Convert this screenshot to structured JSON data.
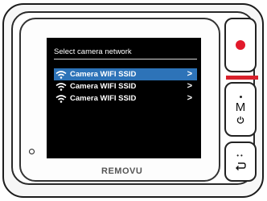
{
  "screen": {
    "title": "Select camera network",
    "networks": [
      {
        "label": "Camera WIFI SSID",
        "selected": true
      },
      {
        "label": "Camera WIFI SSID",
        "selected": false
      },
      {
        "label": "Camera WIFI SSID",
        "selected": false
      }
    ],
    "chevron": ">",
    "selected_color": "#2d73b8"
  },
  "device": {
    "brand": "REMOVU"
  },
  "buttons": {
    "record": {
      "icon": "record-dot-icon",
      "color": "#e2192b"
    },
    "mode": {
      "label": "M",
      "icon": "power-icon"
    },
    "back": {
      "dots": "••",
      "icon": "return-arrow-icon"
    }
  }
}
